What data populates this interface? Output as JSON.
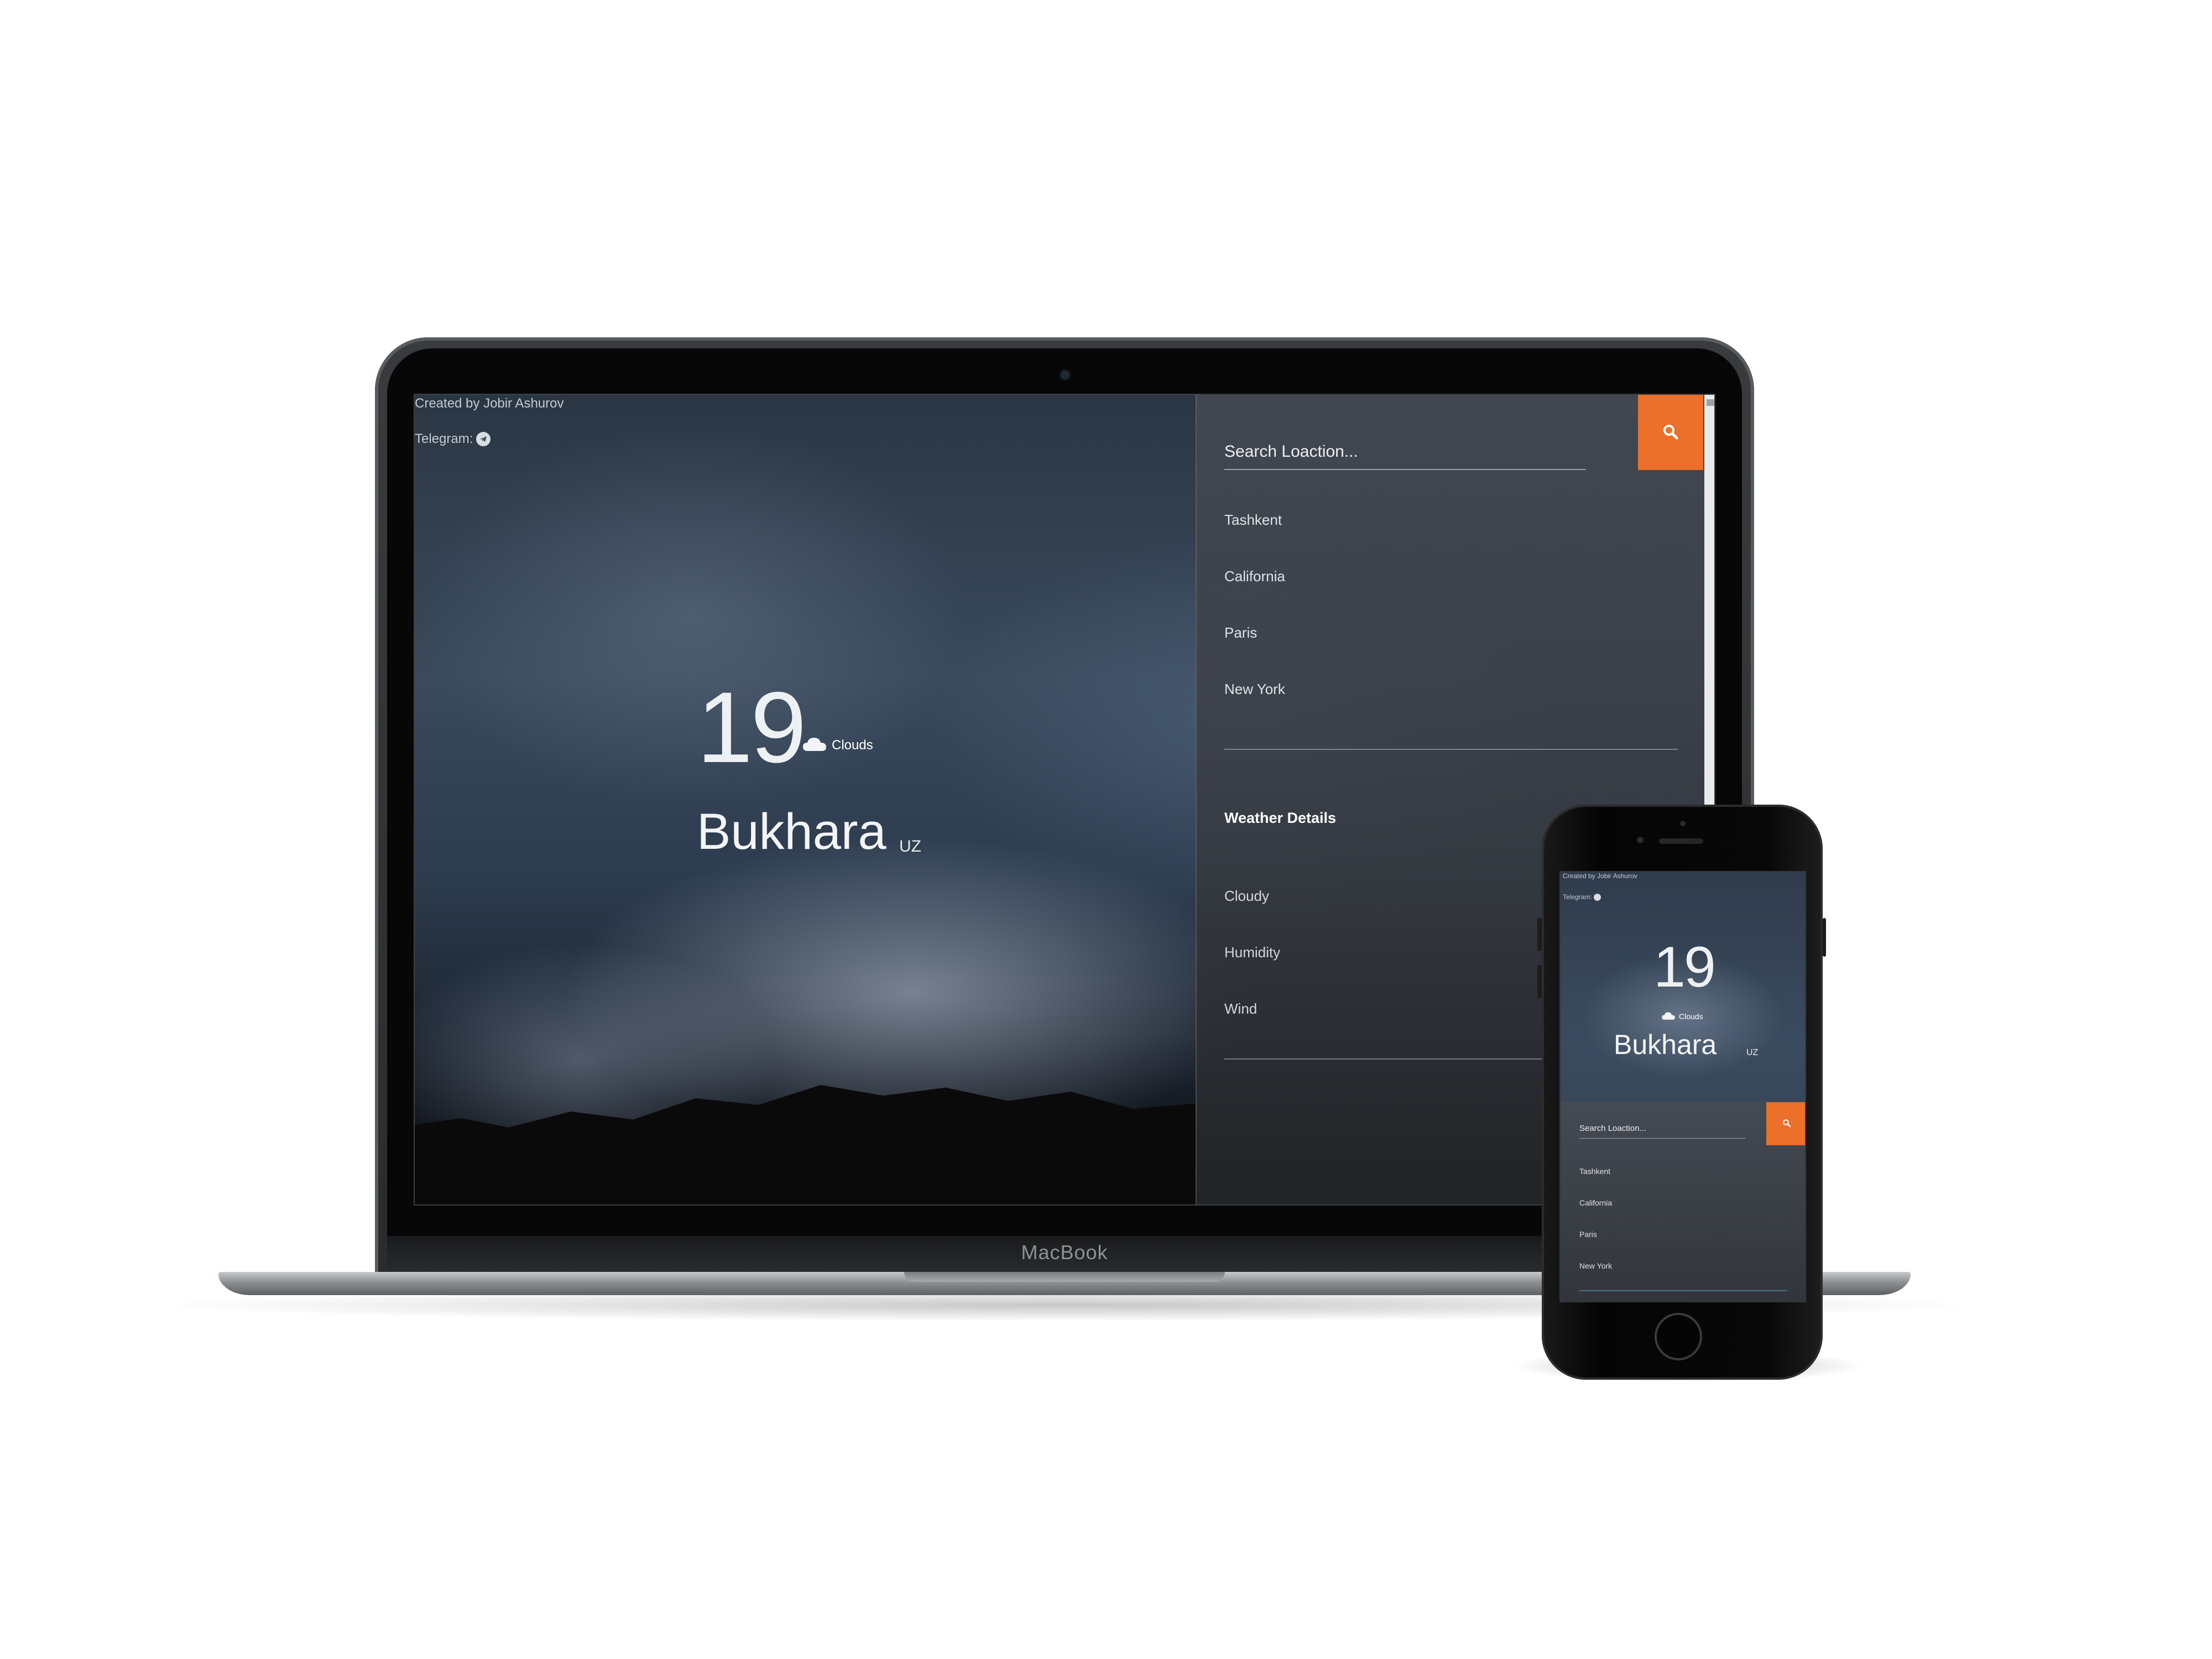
{
  "app": {
    "credit": "Created by Jobir Ashurov",
    "telegram_label": "Telegram:",
    "temperature": "19",
    "condition": "Clouds",
    "city": "Bukhara",
    "country": "UZ"
  },
  "search": {
    "placeholder": "Search Loaction..."
  },
  "locations": [
    "Tashkent",
    "California",
    "Paris",
    "New York"
  ],
  "details": {
    "title": "Weather Details",
    "items": [
      "Cloudy",
      "Humidity",
      "Wind"
    ]
  },
  "devices": {
    "laptop_brand": "MacBook"
  },
  "colors": {
    "accent": "#ec6f2a",
    "text": "#ffffff",
    "panel": "#3b3e44"
  },
  "icons": {
    "search": "search-icon",
    "telegram": "telegram-icon",
    "condition": "cloud-icon"
  }
}
